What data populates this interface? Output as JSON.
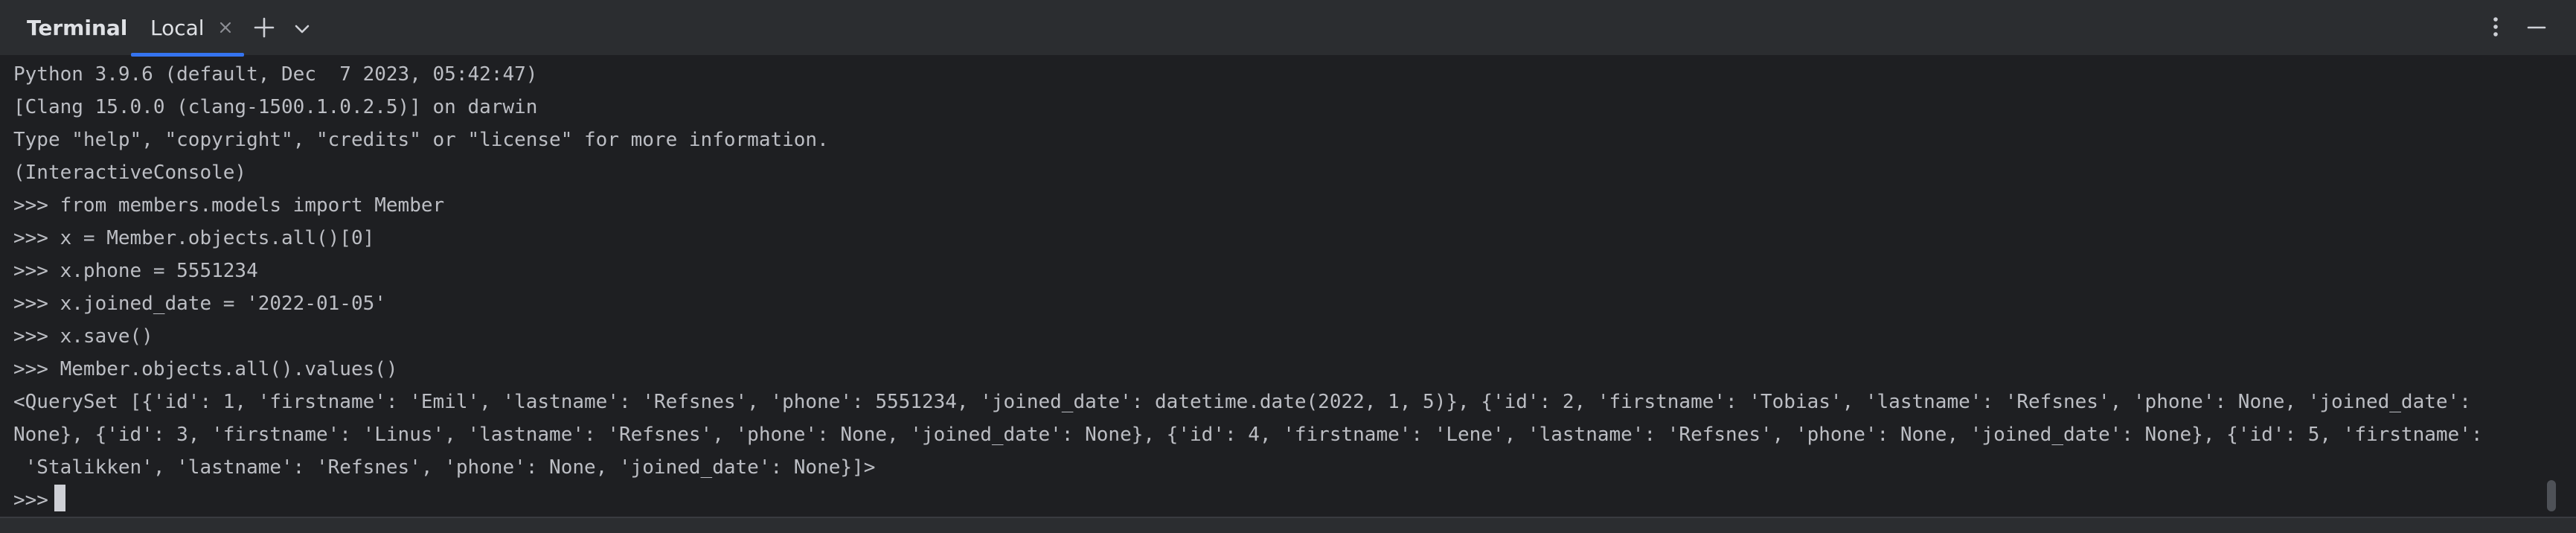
{
  "panel": {
    "title": "Terminal",
    "tabs": [
      {
        "label": "Local",
        "active": true
      }
    ],
    "icons": {
      "tab_close": "close-icon",
      "new_tab": "plus-icon",
      "tab_menu": "chevron-down-icon",
      "options": "more-vertical-icon",
      "hide": "minimize-icon"
    }
  },
  "terminal": {
    "lines": [
      "Python 3.9.6 (default, Dec  7 2023, 05:42:47)",
      "[Clang 15.0.0 (clang-1500.1.0.2.5)] on darwin",
      "Type \"help\", \"copyright\", \"credits\" or \"license\" for more information.",
      "(InteractiveConsole)",
      ">>> from members.models import Member",
      ">>> x = Member.objects.all()[0]",
      ">>> x.phone = 5551234",
      ">>> x.joined_date = '2022-01-05'",
      ">>> x.save()",
      ">>> Member.objects.all().values()",
      "<QuerySet [{'id': 1, 'firstname': 'Emil', 'lastname': 'Refsnes', 'phone': 5551234, 'joined_date': datetime.date(2022, 1, 5)}, {'id': 2, 'firstname': 'Tobias', 'lastname': 'Refsnes', 'phone': None, 'joined_date':",
      "None}, {'id': 3, 'firstname': 'Linus', 'lastname': 'Refsnes', 'phone': None, 'joined_date': None}, {'id': 4, 'firstname': 'Lene', 'lastname': 'Refsnes', 'phone': None, 'joined_date': None}, {'id': 5, 'firstname':",
      " 'Stalikken', 'lastname': 'Refsnes', 'phone': None, 'joined_date': None}]>"
    ],
    "prompt": ">>>"
  },
  "colors": {
    "background": "#1e1f22",
    "header": "#2b2d30",
    "text": "#bcbec4",
    "accent": "#3574f0",
    "cursor": "#ced0d6"
  }
}
